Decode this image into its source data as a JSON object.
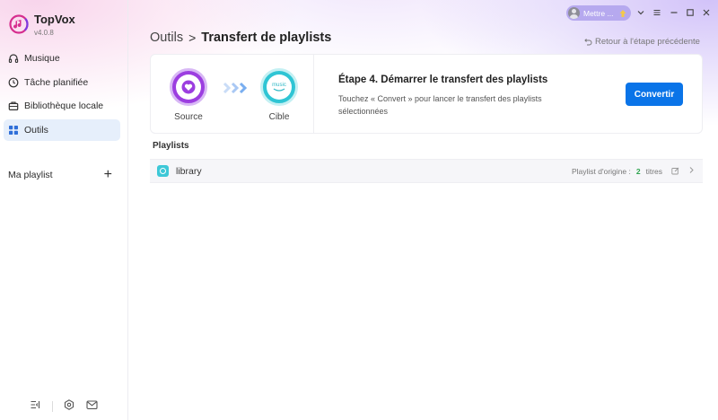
{
  "app": {
    "name": "TopVox",
    "version": "v4.0.8",
    "accent_color": "#0a74e8"
  },
  "topbar": {
    "user_label": "Mettre ...",
    "icons": [
      "upgrade-icon",
      "chevron-down-icon",
      "menu-icon",
      "minimize-icon",
      "maximize-icon",
      "close-icon"
    ]
  },
  "sidebar": {
    "items": [
      {
        "label": "Musique",
        "icon": "headphones-icon"
      },
      {
        "label": "Tâche planifiée",
        "icon": "clock-icon"
      },
      {
        "label": "Bibliothèque locale",
        "icon": "briefcase-icon"
      },
      {
        "label": "Outils",
        "icon": "grid-icon",
        "active": true
      }
    ],
    "my_playlist_label": "Ma playlist",
    "add_label": "+",
    "bottom_icons": [
      "sidebar-collapse-icon",
      "settings-icon",
      "mail-icon"
    ]
  },
  "breadcrumb": {
    "root": "Outils",
    "separator": ">",
    "current": "Transfert de playlists"
  },
  "back_link": "Retour à l'étape précédente",
  "transfer": {
    "source_label": "Source",
    "target_label": "Cible",
    "target_logo_text": "music",
    "step_title": "Étape 4. Démarrer le transfert des playlists",
    "step_desc": "Touchez « Convert » pour lancer le transfert des playlists sélectionnées",
    "convert_button": "Convertir",
    "source_color": "#9c3ee0",
    "target_color": "#2fc5d4"
  },
  "playlists": {
    "section_title": "Playlists",
    "rows": [
      {
        "name": "library",
        "origin_label": "Playlist d'origine :",
        "count": "2",
        "unit": "titres"
      }
    ]
  }
}
